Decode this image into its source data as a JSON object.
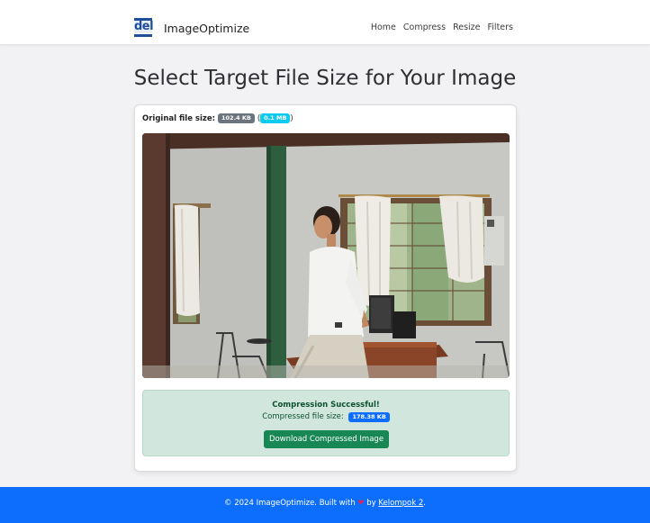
{
  "brand": {
    "logo_text": "del",
    "name": "ImageOptimize"
  },
  "nav": {
    "items": [
      "Home",
      "Compress",
      "Resize",
      "Filters"
    ]
  },
  "page": {
    "title": "Select Target File Size for Your Image"
  },
  "original": {
    "label": "Original file size:",
    "size_kb": "102.4 KB",
    "paren_open": "(",
    "size_mb": "0.1 MB",
    "paren_close": ")"
  },
  "result": {
    "title": "Compression Successful!",
    "compressed_label": "Compressed file size:",
    "compressed_size": "178.38 KB",
    "download_label": "Download Compressed Image"
  },
  "footer": {
    "prefix": "© 2024 ImageOptimize. Built with",
    "heart": "❤",
    "by": "by",
    "link": "Kelompok 2",
    "suffix": "."
  },
  "colors": {
    "primary": "#0d6efd",
    "success": "#198754",
    "success_bg": "#d1e7dd",
    "badge_gray": "#6c757d",
    "badge_cyan": "#0dcaf0"
  }
}
